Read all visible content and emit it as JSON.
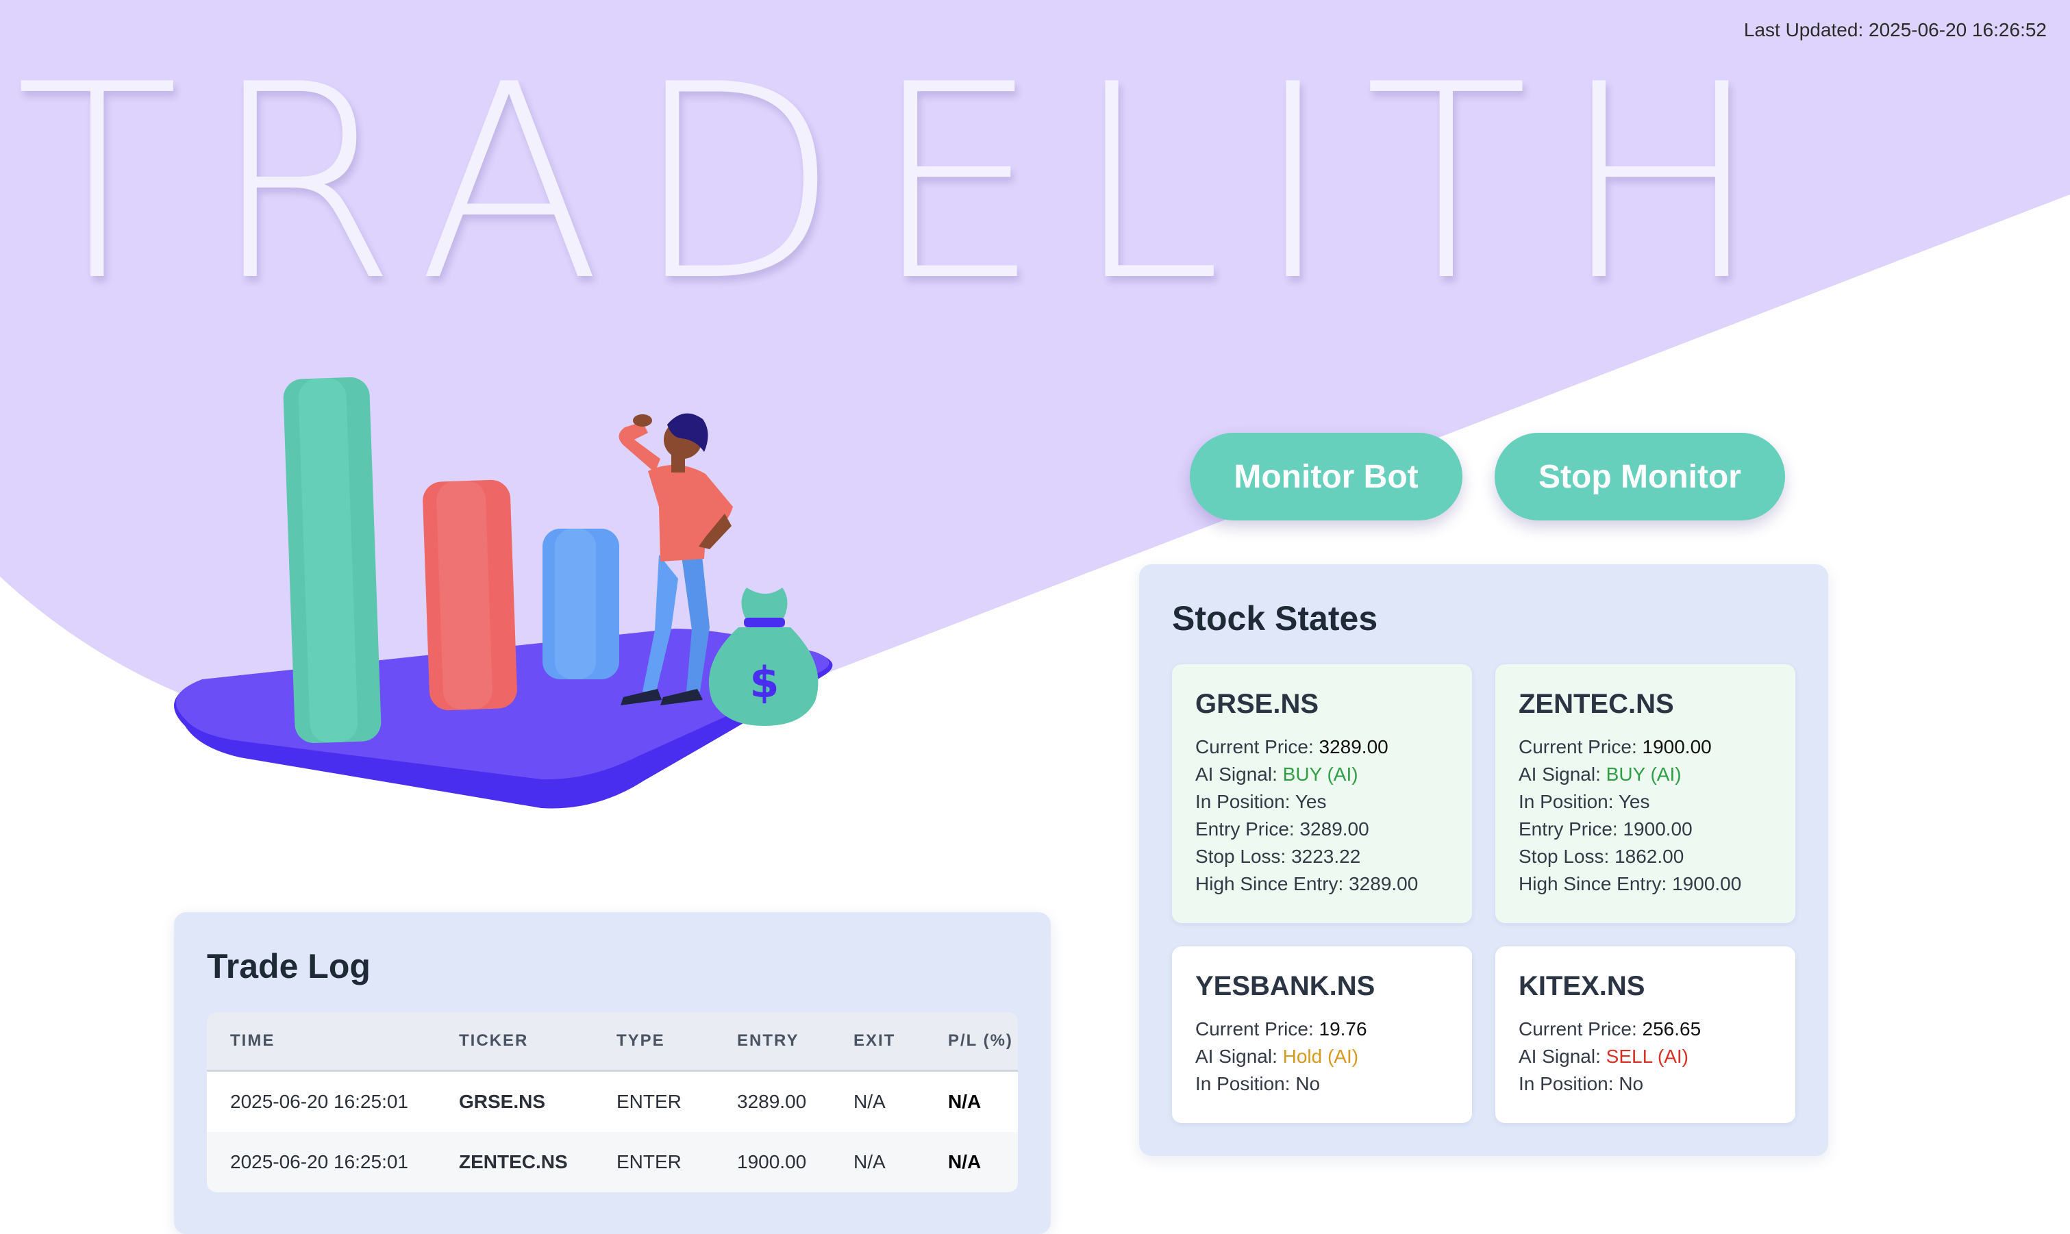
{
  "header": {
    "last_updated": "Last Updated: 2025-06-20 16:26:52",
    "brand": "TRADELITH"
  },
  "colors": {
    "hero_lavender": "#ddd3fc",
    "accent_teal": "#66d0bd",
    "panel_bg": "#dfe7f9",
    "buy_green": "#2f9e44",
    "hold_amber": "#d69a1e",
    "sell_red": "#d93025"
  },
  "controls": {
    "monitor_bot": "Monitor Bot",
    "stop_monitor": "Stop Monitor"
  },
  "stock_states": {
    "title": "Stock States",
    "label_current_price": "Current Price:",
    "label_ai_signal": "AI Signal:",
    "label_in_position": "In Position:",
    "label_entry_price": "Entry Price:",
    "label_stop_loss": "Stop Loss:",
    "label_high_since_entry": "High Since Entry:",
    "cards": [
      {
        "ticker": "GRSE.NS",
        "current_price": "3289.00",
        "ai_signal": "BUY (AI)",
        "in_position": "Yes",
        "entry_price": "3289.00",
        "stop_loss": "3223.22",
        "high_since_entry": "3289.00"
      },
      {
        "ticker": "ZENTEC.NS",
        "current_price": "1900.00",
        "ai_signal": "BUY (AI)",
        "in_position": "Yes",
        "entry_price": "1900.00",
        "stop_loss": "1862.00",
        "high_since_entry": "1900.00"
      },
      {
        "ticker": "YESBANK.NS",
        "current_price": "19.76",
        "ai_signal": "Hold (AI)",
        "in_position": "No"
      },
      {
        "ticker": "KITEX.NS",
        "current_price": "256.65",
        "ai_signal": "SELL (AI)",
        "in_position": "No"
      }
    ]
  },
  "trade_log": {
    "title": "Trade Log",
    "columns": [
      "TIME",
      "TICKER",
      "TYPE",
      "ENTRY",
      "EXIT",
      "P/L (%)"
    ],
    "rows": [
      {
        "time": "2025-06-20 16:25:01",
        "ticker": "GRSE.NS",
        "type": "ENTER",
        "entry": "3289.00",
        "exit": "N/A",
        "pl": "N/A"
      },
      {
        "time": "2025-06-20 16:25:01",
        "ticker": "ZENTEC.NS",
        "type": "ENTER",
        "entry": "1900.00",
        "exit": "N/A",
        "pl": "N/A"
      }
    ]
  },
  "illustration": {
    "icons": [
      "bar-chart-illustration",
      "person-illustration",
      "money-bag-icon"
    ],
    "money_bag_symbol": "$"
  }
}
